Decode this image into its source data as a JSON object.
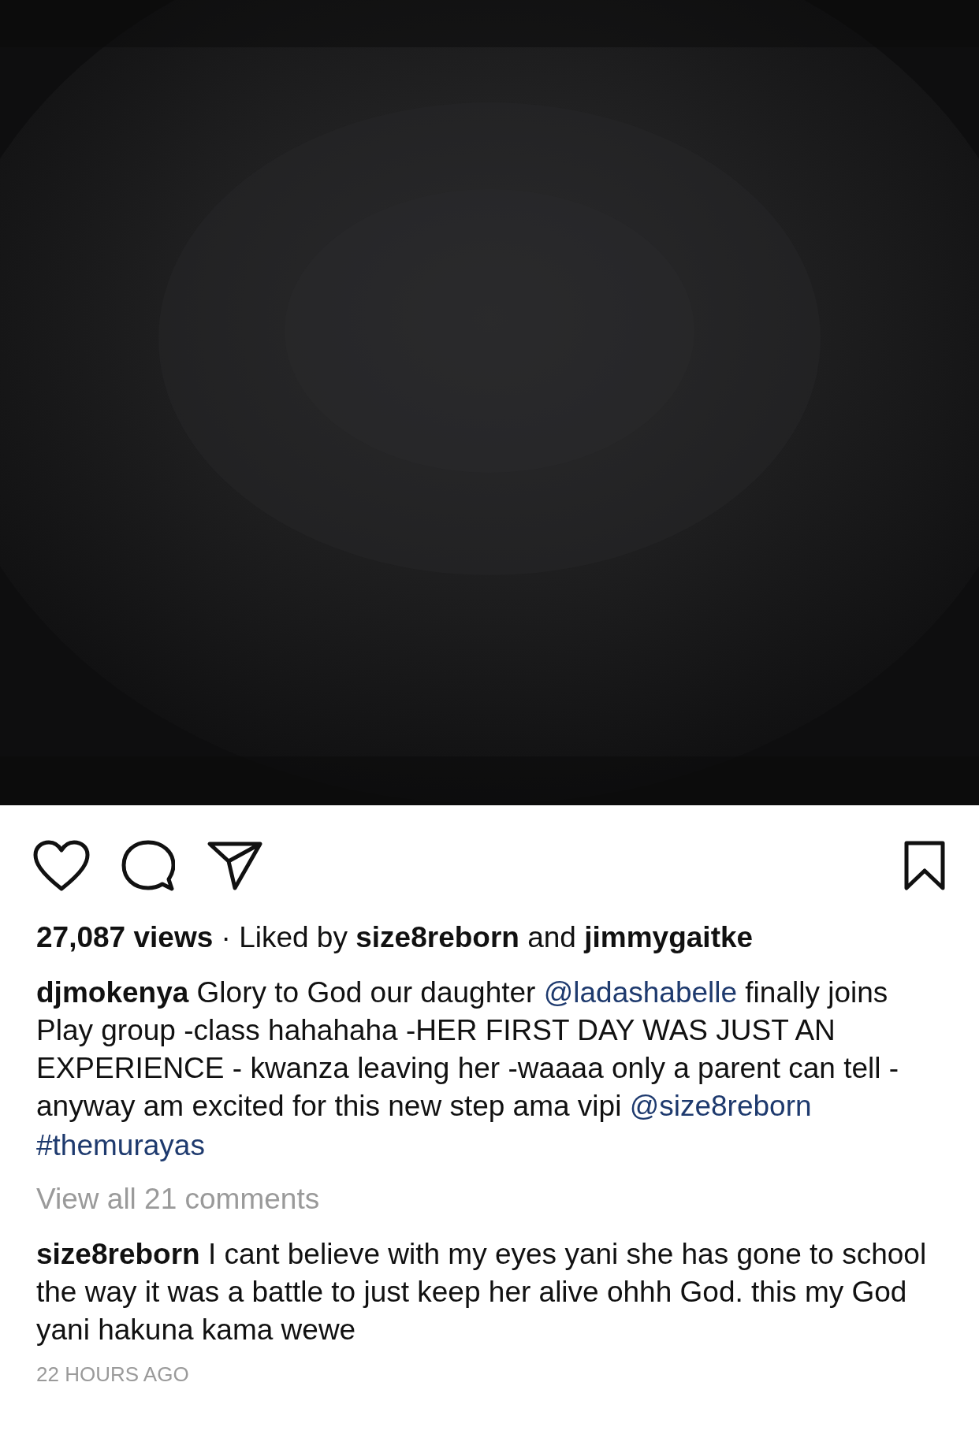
{
  "post": {
    "actions": {
      "liked": false,
      "saved": false
    },
    "likes": "**27,087 views** · Liked by **size8reborn** and **jimmygaitke**",
    "caption": {
      "username": "djmokenya",
      "parts": [
        {
          "kind": "text",
          "text": " Glory to God our daughter "
        },
        {
          "kind": "mention",
          "text": "@ladashabelle"
        },
        {
          "kind": "text",
          "text": " finally joins Play group -class hahahaha -HER FIRST DAY WAS JUST AN EXPERIENCE - kwanza leaving her -waaaa only a parent can tell - anyway am excited for this new step ama vipi "
        },
        {
          "kind": "mention",
          "text": "@size8reborn"
        }
      ],
      "hashtag": "#themurayas"
    },
    "view_comments": "View all 21 comments",
    "comments": [
      {
        "username": "size8reborn",
        "text": " I cant believe with my eyes yani she has gone to school the way it was a battle to just keep her alive ohhh God. this my God yani hakuna kama wewe"
      }
    ],
    "time": "22 HOURS AGO"
  }
}
